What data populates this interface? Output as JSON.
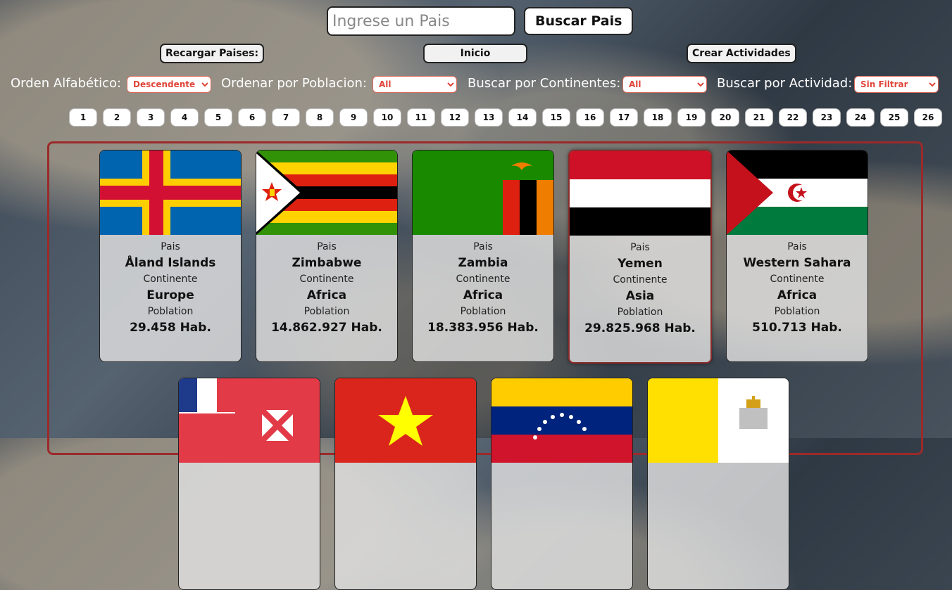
{
  "search": {
    "placeholder": "Ingrese un Pais",
    "button_label": "Buscar Pais"
  },
  "nav": {
    "reload_label": "Recargar Paises:",
    "home_label": "Inicio",
    "create_label": "Crear Actividades"
  },
  "filters": {
    "alpha": {
      "label": "Orden Alfabético:",
      "value": "Descendente"
    },
    "population": {
      "label": "Ordenar por Poblacion:",
      "value": "All"
    },
    "continent": {
      "label": "Buscar por Continentes:",
      "value": "All"
    },
    "activity": {
      "label": "Buscar por Actividad:",
      "value": "Sin Filtrar"
    }
  },
  "pages": [
    "1",
    "2",
    "3",
    "4",
    "5",
    "6",
    "7",
    "8",
    "9",
    "10",
    "11",
    "12",
    "13",
    "14",
    "15",
    "16",
    "17",
    "18",
    "19",
    "20",
    "21",
    "22",
    "23",
    "24",
    "25",
    "26"
  ],
  "card_labels": {
    "country": "Pais",
    "continent": "Continente",
    "population": "Poblation"
  },
  "countries": [
    {
      "name": "Åland Islands",
      "continent": "Europe",
      "population": "29.458 Hab."
    },
    {
      "name": "Zimbabwe",
      "continent": "Africa",
      "population": "14.862.927 Hab."
    },
    {
      "name": "Zambia",
      "continent": "Africa",
      "population": "18.383.956 Hab."
    },
    {
      "name": "Yemen",
      "continent": "Asia",
      "population": "29.825.968 Hab."
    },
    {
      "name": "Western Sahara",
      "continent": "Africa",
      "population": "510.713 Hab."
    }
  ],
  "colors": {
    "accent_border": "#9b2a2a",
    "select_text": "#e0453a"
  }
}
